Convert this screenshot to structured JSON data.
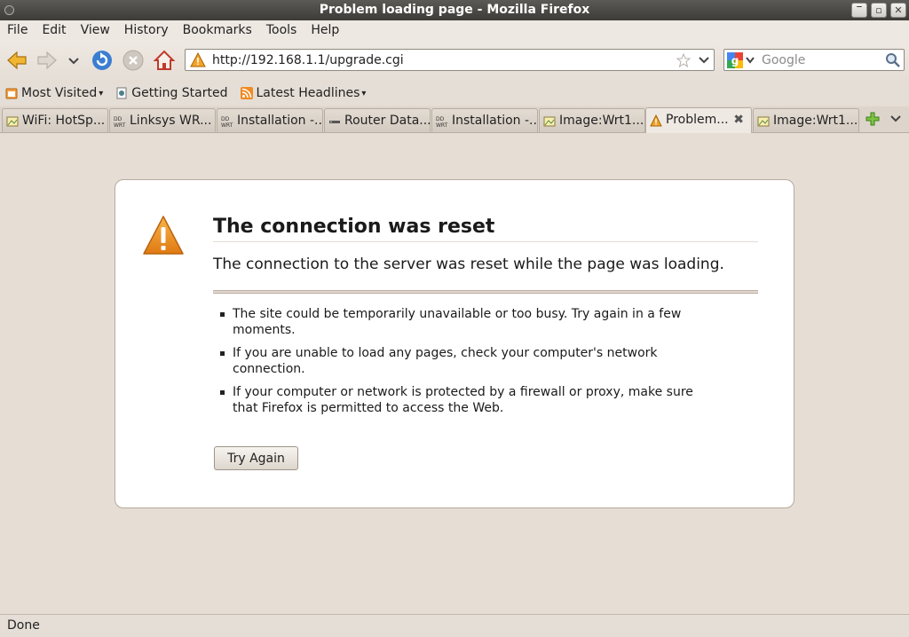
{
  "window": {
    "title": "Problem loading page - Mozilla Firefox"
  },
  "menu": [
    "File",
    "Edit",
    "View",
    "History",
    "Bookmarks",
    "Tools",
    "Help"
  ],
  "toolbar": {
    "url": "http://192.168.1.1/upgrade.cgi",
    "search_placeholder": "Google"
  },
  "bookmarks": [
    {
      "label": "Most Visited",
      "icon": "folder-rss-icon",
      "dropdown": true
    },
    {
      "label": "Getting Started",
      "icon": "page-icon",
      "dropdown": false
    },
    {
      "label": "Latest Headlines",
      "icon": "rss-icon",
      "dropdown": true
    }
  ],
  "tabs": [
    {
      "label": "WiFi: HotSp...",
      "icon": "image-icon",
      "active": false
    },
    {
      "label": "Linksys WR...",
      "icon": "ddwrt-icon",
      "active": false
    },
    {
      "label": "Installation -...",
      "icon": "ddwrt-icon",
      "active": false
    },
    {
      "label": "Router Data...",
      "icon": "router-icon",
      "active": false
    },
    {
      "label": "Installation -...",
      "icon": "ddwrt-icon",
      "active": false
    },
    {
      "label": "Image:Wrt1...",
      "icon": "image-icon",
      "active": false
    },
    {
      "label": "Problem...",
      "icon": "warning-icon",
      "active": true
    },
    {
      "label": "Image:Wrt1...",
      "icon": "image-icon",
      "active": false
    }
  ],
  "error": {
    "title": "The connection was reset",
    "short_desc": "The connection to the server was reset while the page was loading.",
    "bullets": [
      "The site could be temporarily unavailable or too busy. Try again in a few moments.",
      "If you are unable to load any pages, check your computer's network connection.",
      "If your computer or network is protected by a firewall or proxy, make sure that Firefox is permitted to access the Web."
    ],
    "button": "Try Again"
  },
  "status": {
    "text": "Done"
  },
  "colors": {
    "accent_warning": "#e8861c",
    "home_red": "#c0392b",
    "reload_blue": "#3b7ed1"
  }
}
